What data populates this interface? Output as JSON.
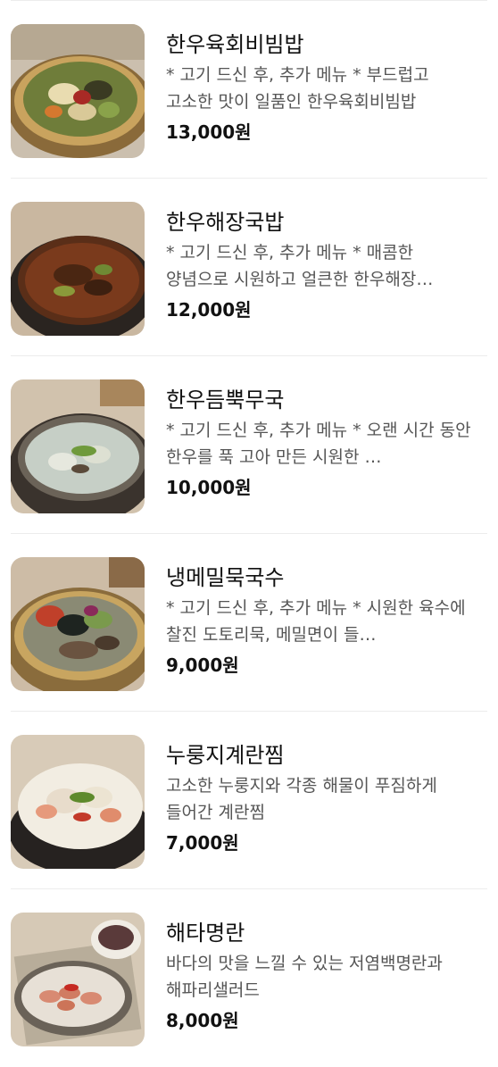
{
  "menu": {
    "items": [
      {
        "name": "한우육회비빔밥",
        "description": "* 고기 드신 후, 추가 메뉴 * 부드럽고 고소한 맛이 일품인 한우육회비빔밥",
        "price": "13,000원",
        "image": "bibimbap-photo"
      },
      {
        "name": "한우해장국밥",
        "description": "* 고기 드신 후, 추가 메뉴 * 매콤한 양념으로 시원하고 얼큰한 한우해장…",
        "price": "12,000원",
        "image": "haejangguk-photo"
      },
      {
        "name": "한우듬뿍무국",
        "description": "* 고기 드신 후, 추가 메뉴 * 오랜 시간 동안 한우를 푹 고아 만든 시원한 …",
        "price": "10,000원",
        "image": "radish-soup-photo"
      },
      {
        "name": "냉메밀묵국수",
        "description": "* 고기 드신 후, 추가 메뉴 * 시원한 육수에 찰진 도토리묵, 메밀면이 들…",
        "price": "9,000원",
        "image": "cold-buckwheat-noodle-photo"
      },
      {
        "name": "누룽지계란찜",
        "description": "고소한 누룽지와 각종 해물이 푸짐하게 들어간 계란찜",
        "price": "7,000원",
        "image": "steamed-egg-photo"
      },
      {
        "name": "해타명란",
        "description": "바다의 맛을 느낄 수 있는 저염백명란과 해파리샐러드",
        "price": "8,000원",
        "image": "pollock-roe-photo"
      }
    ]
  },
  "colors": {
    "background": "#ffffff",
    "divider": "#ececec",
    "name_text": "#111111",
    "desc_text": "#555555"
  }
}
